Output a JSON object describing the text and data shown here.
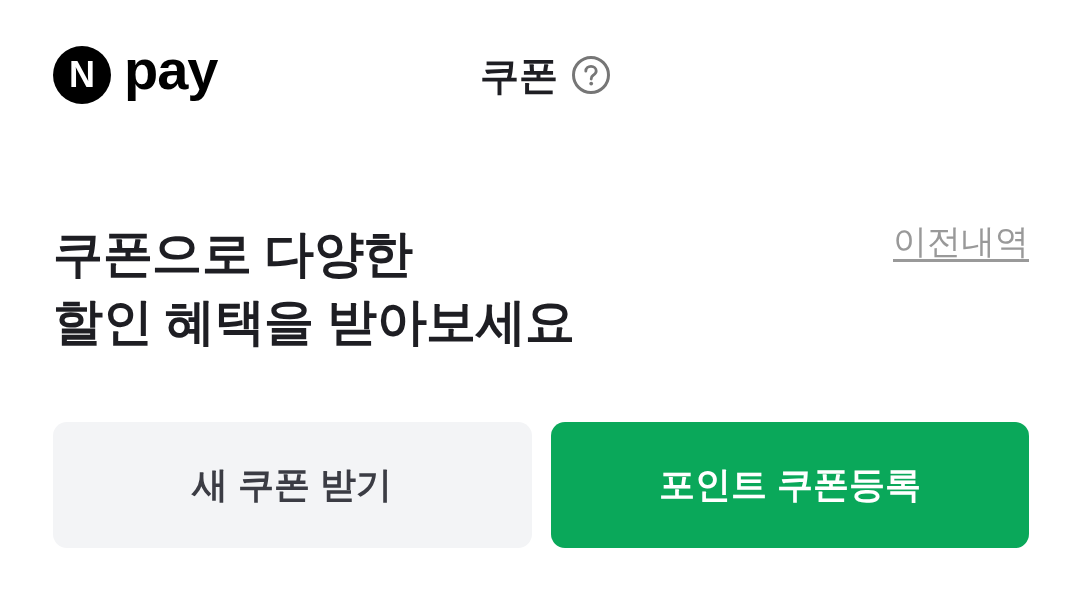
{
  "header": {
    "logo": {
      "mark": "N",
      "text": "pay"
    },
    "title": "쿠폰"
  },
  "intro": {
    "headline_lines": [
      "쿠폰으로 다양한",
      "할인 혜택을 받아보세요"
    ],
    "history_link": "이전내역"
  },
  "buttons": [
    {
      "label": "새 쿠폰 받기",
      "kind": "secondary"
    },
    {
      "label": "포인트 쿠폰등록",
      "kind": "primary"
    }
  ]
}
